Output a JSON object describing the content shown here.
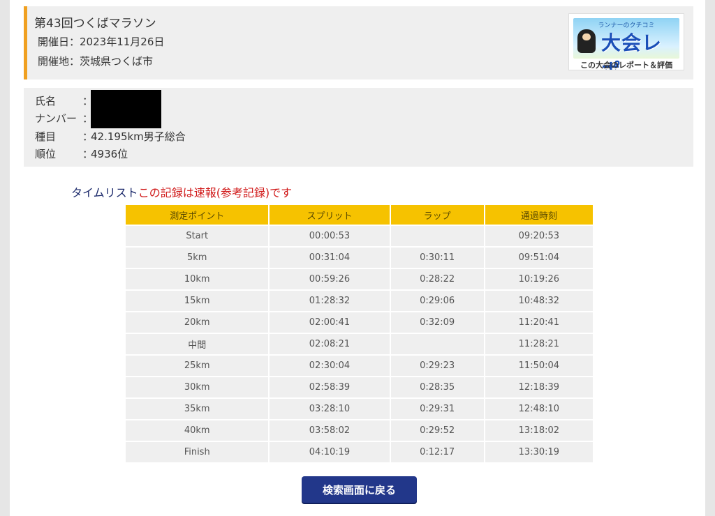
{
  "event": {
    "title": "第43回つくばマラソン",
    "date_label": "開催日：",
    "date_value": "2023年11月26日",
    "place_label": "開催地：",
    "place_value": "茨城県つくば市"
  },
  "banner": {
    "subtitle": "ランナーのクチコミ",
    "main": "大会レポ",
    "caption": "この大会のレポート＆評価"
  },
  "runner": {
    "separator": "：",
    "name_label": "氏名",
    "name_value": "",
    "number_label": "ナンバー",
    "number_value": "",
    "category_label": "種目",
    "category_value": "42.195km男子総合",
    "rank_label": "順位",
    "rank_value": "4936位"
  },
  "timelist": {
    "label": "タイムリスト",
    "note": "この記録は速報(参考記録)です",
    "headers": [
      "測定ポイント",
      "スプリット",
      "ラップ",
      "通過時刻"
    ],
    "rows": [
      {
        "point": "Start",
        "split": "00:00:53",
        "lap": "",
        "time": "09:20:53"
      },
      {
        "point": "5km",
        "split": "00:31:04",
        "lap": "0:30:11",
        "time": "09:51:04"
      },
      {
        "point": "10km",
        "split": "00:59:26",
        "lap": "0:28:22",
        "time": "10:19:26"
      },
      {
        "point": "15km",
        "split": "01:28:32",
        "lap": "0:29:06",
        "time": "10:48:32"
      },
      {
        "point": "20km",
        "split": "02:00:41",
        "lap": "0:32:09",
        "time": "11:20:41"
      },
      {
        "point": "中間",
        "split": "02:08:21",
        "lap": "",
        "time": "11:28:21"
      },
      {
        "point": "25km",
        "split": "02:30:04",
        "lap": "0:29:23",
        "time": "11:50:04"
      },
      {
        "point": "30km",
        "split": "02:58:39",
        "lap": "0:28:35",
        "time": "12:18:39"
      },
      {
        "point": "35km",
        "split": "03:28:10",
        "lap": "0:29:31",
        "time": "12:48:10"
      },
      {
        "point": "40km",
        "split": "03:58:02",
        "lap": "0:29:52",
        "time": "13:18:02"
      },
      {
        "point": "Finish",
        "split": "04:10:19",
        "lap": "0:12:17",
        "time": "13:30:19"
      }
    ]
  },
  "back_button": {
    "label": "検索画面に戻る"
  },
  "colors": {
    "accent_orange": "#f0a020",
    "table_header": "#f6c200",
    "button_navy": "#22378a",
    "note_red": "#d01818"
  }
}
